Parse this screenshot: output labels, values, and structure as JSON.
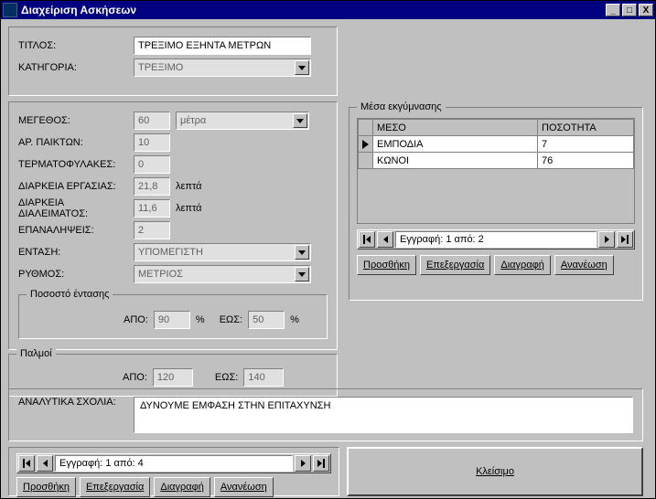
{
  "window": {
    "title": "Διαχείριση Ασκήσεων"
  },
  "labels": {
    "titlos": "ΤΙΤΛΟΣ:",
    "katigoria": "ΚΑΤΗΓΟΡΙΑ:",
    "megethos": "ΜΕΓΕΘΟΣ:",
    "arpaikton": "ΑΡ. ΠΑΙΚΤΩΝ:",
    "termato": "ΤΕΡΜΑΤΟΦΥΛΑΚΕΣ:",
    "diarkeia_erg": "ΔΙΑΡΚΕΙΑ ΕΡΓΑΣΙΑΣ:",
    "diarkeia_dia": "ΔΙΑΡΚΕΙΑ ΔΙΑΛΕΙΜΑΤΟΣ:",
    "epanal": "ΕΠΑΝΑΛΗΨΕΙΣ:",
    "entasi": "ΕΝΤΑΣΗ:",
    "rythmos": "ΡΥΘΜΟΣ:",
    "lepta": "λεπτά",
    "pososto_leg": "Ποσοστό έντασης",
    "palmoi_leg": "Παλμοί",
    "apo": "ΑΠΟ:",
    "eos": "ΕΩΣ:",
    "pct": "%",
    "analytika": "ΑΝΑΛΥΤΙΚΑ ΣΧΟΛΙΑ:",
    "mesa_leg": "Μέσα εκγύμνασης"
  },
  "form": {
    "titlos": "ΤΡΕΞΙΜΟ ΕΞΗΝΤΑ ΜΕΤΡΩΝ",
    "katigoria": "ΤΡΕΞΙΜΟ",
    "megethos": "60",
    "megethos_unit": "μέτρα",
    "arpaikton": "10",
    "termato": "0",
    "diarkeia_erg": "21,8",
    "diarkeia_dia": "11,6",
    "epanal": "2",
    "entasi": "ΥΠΟΜΕΓΙΣΤΗ",
    "rythmos": "ΜΕΤΡΙΟΣ",
    "pososto_apo": "90",
    "pososto_eos": "50",
    "palmoi_apo": "120",
    "palmoi_eos": "140",
    "sxolia": "ΔΥΝΟΥΜΕ ΕΜΦΑΣΗ ΣΤΗΝ ΕΠΙΤΑΧΥΝΣΗ"
  },
  "grid": {
    "col_meso": "ΜΕΣΟ",
    "col_posotita": "ΠΟΣΟΤΗΤΑ",
    "rows": [
      {
        "meso": "ΕΜΠΟΔΙΑ",
        "posotita": "7"
      },
      {
        "meso": "ΚΩΝΟΙ",
        "posotita": "76"
      }
    ]
  },
  "nav_main": {
    "text": "Εγγραφή: 1 από: 4"
  },
  "nav_grid": {
    "text": "Εγγραφή: 1 από: 2"
  },
  "buttons": {
    "prosthiki": "Προσθήκη",
    "epexergasia": "Επεξεργασία",
    "diagrafi": "Διαγραφή",
    "ananeosi": "Ανανέωση",
    "kleisimo": "Κλείσιμο"
  }
}
